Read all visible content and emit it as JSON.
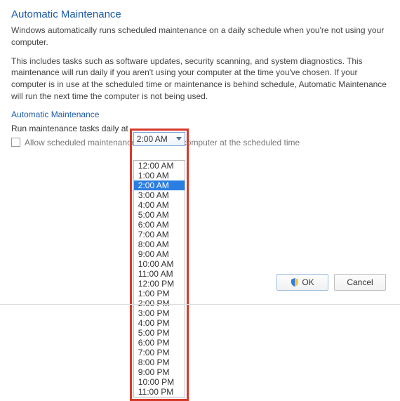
{
  "title": "Automatic Maintenance",
  "para1": "Windows automatically runs scheduled maintenance on a daily schedule when you're not using your computer.",
  "para2": "This includes tasks such as software updates, security scanning, and system diagnostics. This maintenance will run daily if you aren't using your computer at the time you've chosen. If your computer is in use at the scheduled time or maintenance is behind schedule, Automatic Maintenance will run the next time the computer is not being used.",
  "section_label": "Automatic Maintenance",
  "run_label": "Run maintenance tasks daily at",
  "time_select": {
    "selected": "2:00 AM",
    "options": [
      "12:00 AM",
      "1:00 AM",
      "2:00 AM",
      "3:00 AM",
      "4:00 AM",
      "5:00 AM",
      "6:00 AM",
      "7:00 AM",
      "8:00 AM",
      "9:00 AM",
      "10:00 AM",
      "11:00 AM",
      "12:00 PM",
      "1:00 PM",
      "2:00 PM",
      "3:00 PM",
      "4:00 PM",
      "5:00 PM",
      "6:00 PM",
      "7:00 PM",
      "8:00 PM",
      "9:00 PM",
      "10:00 PM",
      "11:00 PM"
    ]
  },
  "wake_label_pre": "Allow scheduled maintenance",
  "wake_label_post": "computer at the scheduled time",
  "buttons": {
    "ok": "OK",
    "cancel": "Cancel"
  }
}
